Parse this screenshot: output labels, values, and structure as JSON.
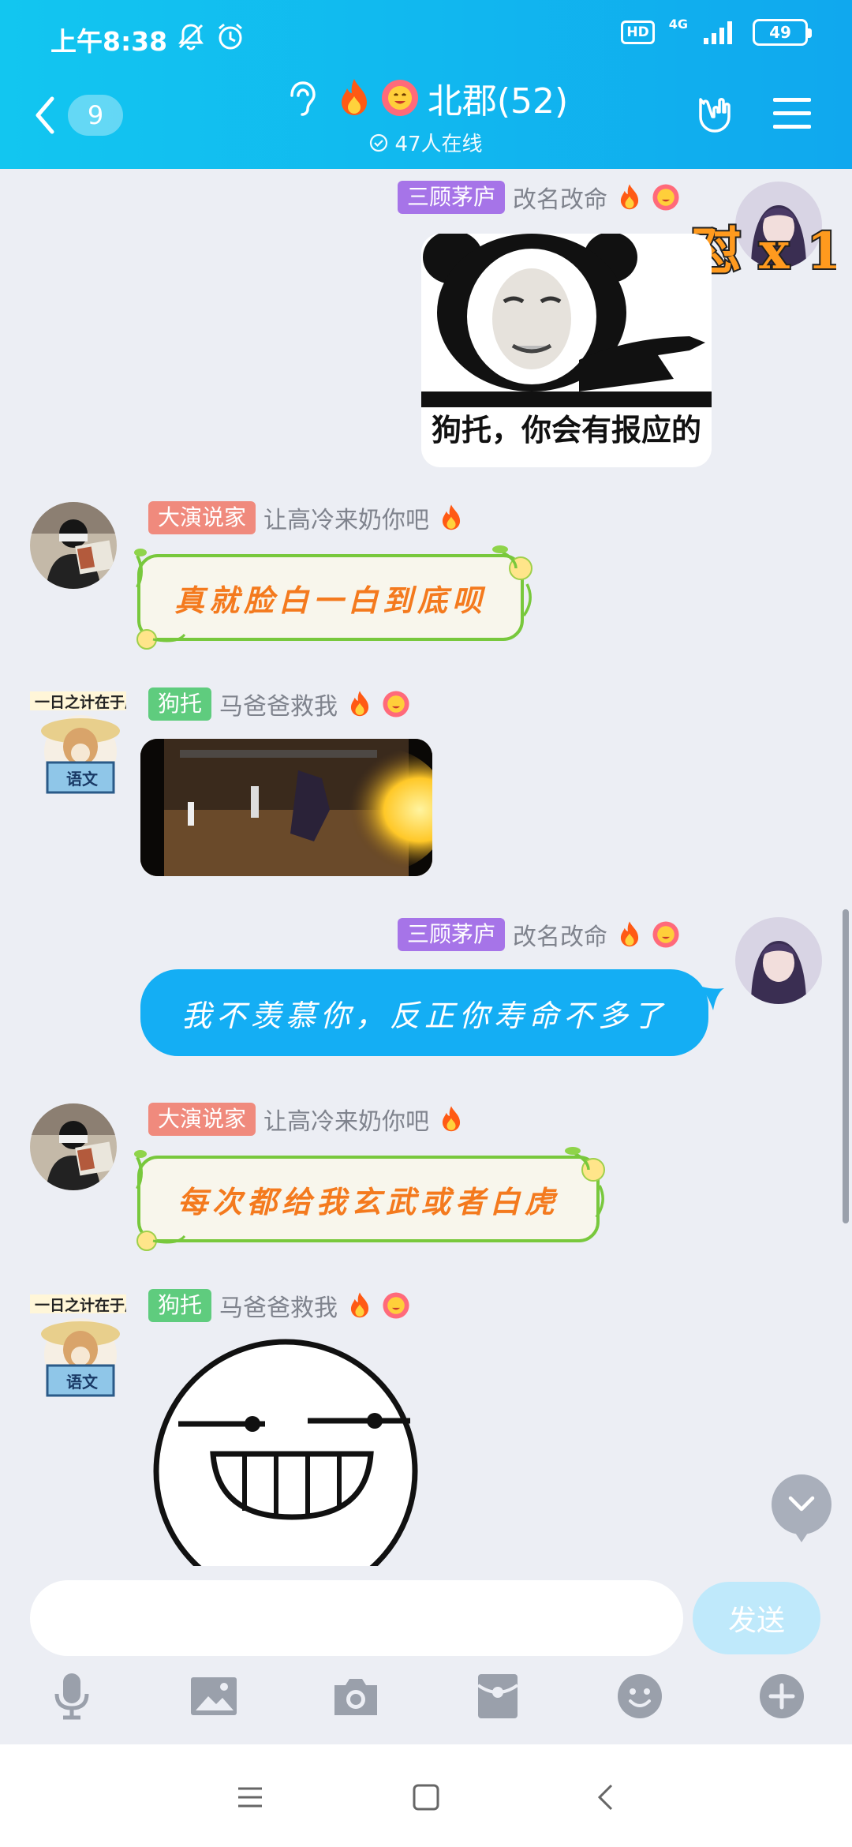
{
  "status_bar": {
    "time": "上午8:38",
    "hd": "HD",
    "network": "4G",
    "battery": "49"
  },
  "header": {
    "back_count": "9",
    "group_name": "北郡(52)",
    "online_text": "47人在线"
  },
  "colors": {
    "header": "#11b8ef",
    "bubble_self": "#14aef4",
    "vine_text": "#f47a1e",
    "vine_border": "#78c83c"
  },
  "messages": [
    {
      "side": "right",
      "badge": "三顾茅庐",
      "name": "改名改命",
      "type": "sticker",
      "caption": "狗托，你会有报应的",
      "overlay": "怼 x 1"
    },
    {
      "side": "left",
      "badge": "大演说家",
      "name": "让高冷来奶你吧",
      "type": "text",
      "text": "真就脸白一白到底呗"
    },
    {
      "side": "left",
      "badge": "狗托",
      "name": "马爸爸救我",
      "type": "video"
    },
    {
      "side": "right",
      "badge": "三顾茅庐",
      "name": "改名改命",
      "type": "text",
      "text": "我不羡慕你，反正你寿命不多了"
    },
    {
      "side": "left",
      "badge": "大演说家",
      "name": "让高冷来奶你吧",
      "type": "text",
      "text": "每次都给我玄武或者白虎"
    },
    {
      "side": "left",
      "badge": "狗托",
      "name": "马爸爸救我",
      "type": "sticker"
    }
  ],
  "avatar_texts": {
    "dog_sign": "一日之计在于晨",
    "dog_book": "语文"
  },
  "input": {
    "placeholder": "",
    "send_label": "发送"
  },
  "toolbar": [
    "mic-icon",
    "image-icon",
    "camera-icon",
    "red-packet-icon",
    "emoji-icon",
    "plus-icon"
  ]
}
